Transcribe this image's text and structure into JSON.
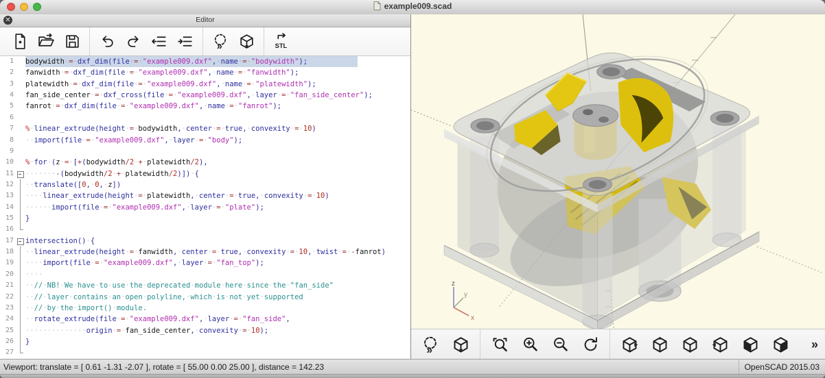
{
  "window": {
    "title": "example009.scad"
  },
  "titlebar": {
    "buttons": [
      "close-button",
      "minimize-button",
      "zoom-button"
    ]
  },
  "editor": {
    "panel_title": "Editor",
    "close_glyph": "✕",
    "toolbar": {
      "groups": [
        [
          "new-file",
          "open",
          "save"
        ],
        [
          "undo",
          "redo",
          "unindent",
          "indent"
        ],
        [
          "preview",
          "render"
        ],
        [
          "export-stl"
        ]
      ]
    },
    "code": {
      "lines": [
        {
          "n": "1",
          "fold": "",
          "selected": true,
          "segments": [
            [
              "id",
              "bodywidth"
            ],
            [
              "op",
              " = "
            ],
            [
              "kw",
              "dxf_dim"
            ],
            [
              "kw",
              "("
            ],
            [
              "kw",
              "file"
            ],
            [
              "op",
              " = "
            ],
            [
              "str",
              "\"example009.dxf\""
            ],
            [
              "kw",
              ", "
            ],
            [
              "kw",
              "name"
            ],
            [
              "op",
              " = "
            ],
            [
              "str",
              "\"bodywidth\""
            ],
            [
              "kw",
              ");"
            ]
          ]
        },
        {
          "n": "2",
          "fold": "",
          "segments": [
            [
              "id",
              "fanwidth"
            ],
            [
              "op",
              " = "
            ],
            [
              "kw",
              "dxf_dim"
            ],
            [
              "kw",
              "("
            ],
            [
              "kw",
              "file"
            ],
            [
              "op",
              " = "
            ],
            [
              "str",
              "\"example009.dxf\""
            ],
            [
              "kw",
              ", "
            ],
            [
              "kw",
              "name"
            ],
            [
              "op",
              " = "
            ],
            [
              "str",
              "\"fanwidth\""
            ],
            [
              "kw",
              ");"
            ]
          ]
        },
        {
          "n": "3",
          "fold": "",
          "segments": [
            [
              "id",
              "platewidth"
            ],
            [
              "op",
              " = "
            ],
            [
              "kw",
              "dxf_dim"
            ],
            [
              "kw",
              "("
            ],
            [
              "kw",
              "file"
            ],
            [
              "op",
              " = "
            ],
            [
              "str",
              "\"example009.dxf\""
            ],
            [
              "kw",
              ", "
            ],
            [
              "kw",
              "name"
            ],
            [
              "op",
              " = "
            ],
            [
              "str",
              "\"platewidth\""
            ],
            [
              "kw",
              ");"
            ]
          ]
        },
        {
          "n": "4",
          "fold": "",
          "segments": [
            [
              "id",
              "fan_side_center"
            ],
            [
              "op",
              " = "
            ],
            [
              "kw",
              "dxf_cross"
            ],
            [
              "kw",
              "("
            ],
            [
              "kw",
              "file"
            ],
            [
              "op",
              " = "
            ],
            [
              "str",
              "\"example009.dxf\""
            ],
            [
              "kw",
              ", "
            ],
            [
              "kw",
              "layer"
            ],
            [
              "op",
              " = "
            ],
            [
              "str",
              "\"fan_side_center\""
            ],
            [
              "kw",
              ");"
            ]
          ]
        },
        {
          "n": "5",
          "fold": "",
          "segments": [
            [
              "id",
              "fanrot"
            ],
            [
              "op",
              " = "
            ],
            [
              "kw",
              "dxf_dim"
            ],
            [
              "kw",
              "("
            ],
            [
              "kw",
              "file"
            ],
            [
              "op",
              " = "
            ],
            [
              "str",
              "\"example009.dxf\""
            ],
            [
              "kw",
              ", "
            ],
            [
              "kw",
              "name"
            ],
            [
              "op",
              " = "
            ],
            [
              "str",
              "\"fanrot\""
            ],
            [
              "kw",
              ");"
            ]
          ]
        },
        {
          "n": "6",
          "fold": "",
          "segments": []
        },
        {
          "n": "7",
          "fold": "",
          "segments": [
            [
              "mod",
              "% "
            ],
            [
              "kw",
              "linear_extrude"
            ],
            [
              "kw",
              "("
            ],
            [
              "kw",
              "height"
            ],
            [
              "op",
              " = "
            ],
            [
              "id",
              "bodywidth"
            ],
            [
              "kw",
              ", "
            ],
            [
              "kw",
              "center"
            ],
            [
              "op",
              " = "
            ],
            [
              "kw",
              "true"
            ],
            [
              "kw",
              ", "
            ],
            [
              "kw",
              "convexity"
            ],
            [
              "op",
              " = "
            ],
            [
              "num",
              "10"
            ],
            [
              "kw",
              ")"
            ]
          ]
        },
        {
          "n": "8",
          "fold": "",
          "segments": [
            [
              "id",
              "  "
            ],
            [
              "kw",
              "import"
            ],
            [
              "kw",
              "("
            ],
            [
              "kw",
              "file"
            ],
            [
              "op",
              " = "
            ],
            [
              "str",
              "\"example009.dxf\""
            ],
            [
              "kw",
              ", "
            ],
            [
              "kw",
              "layer"
            ],
            [
              "op",
              " = "
            ],
            [
              "str",
              "\"body\""
            ],
            [
              "kw",
              ");"
            ]
          ]
        },
        {
          "n": "9",
          "fold": "",
          "segments": []
        },
        {
          "n": "10",
          "fold": "",
          "segments": [
            [
              "mod",
              "% "
            ],
            [
              "kw",
              "for"
            ],
            [
              "kw",
              " ("
            ],
            [
              "id",
              "z"
            ],
            [
              "op",
              " = "
            ],
            [
              "kw",
              "["
            ],
            [
              "op",
              "+"
            ],
            [
              "kw",
              "("
            ],
            [
              "id",
              "bodywidth"
            ],
            [
              "op",
              "/"
            ],
            [
              "num",
              "2"
            ],
            [
              "op",
              " + "
            ],
            [
              "id",
              "platewidth"
            ],
            [
              "op",
              "/"
            ],
            [
              "num",
              "2"
            ],
            [
              "kw",
              "),"
            ]
          ]
        },
        {
          "n": "11",
          "fold": "open",
          "segments": [
            [
              "id",
              "       "
            ],
            [
              "op",
              "-"
            ],
            [
              "kw",
              "("
            ],
            [
              "id",
              "bodywidth"
            ],
            [
              "op",
              "/"
            ],
            [
              "num",
              "2"
            ],
            [
              "op",
              " + "
            ],
            [
              "id",
              "platewidth"
            ],
            [
              "op",
              "/"
            ],
            [
              "num",
              "2"
            ],
            [
              "kw",
              ")]) {"
            ]
          ]
        },
        {
          "n": "12",
          "fold": "line",
          "segments": [
            [
              "id",
              "  "
            ],
            [
              "kw",
              "translate"
            ],
            [
              "kw",
              "(["
            ],
            [
              "num",
              "0"
            ],
            [
              "kw",
              ", "
            ],
            [
              "num",
              "0"
            ],
            [
              "kw",
              ", "
            ],
            [
              "id",
              "z"
            ],
            [
              "kw",
              "])"
            ]
          ]
        },
        {
          "n": "13",
          "fold": "line",
          "segments": [
            [
              "id",
              "    "
            ],
            [
              "kw",
              "linear_extrude"
            ],
            [
              "kw",
              "("
            ],
            [
              "kw",
              "height"
            ],
            [
              "op",
              " = "
            ],
            [
              "id",
              "platewidth"
            ],
            [
              "kw",
              ", "
            ],
            [
              "kw",
              "center"
            ],
            [
              "op",
              " = "
            ],
            [
              "kw",
              "true"
            ],
            [
              "kw",
              ", "
            ],
            [
              "kw",
              "convexity"
            ],
            [
              "op",
              " = "
            ],
            [
              "num",
              "10"
            ],
            [
              "kw",
              ")"
            ]
          ]
        },
        {
          "n": "14",
          "fold": "line",
          "segments": [
            [
              "id",
              "      "
            ],
            [
              "kw",
              "import"
            ],
            [
              "kw",
              "("
            ],
            [
              "kw",
              "file"
            ],
            [
              "op",
              " = "
            ],
            [
              "str",
              "\"example009.dxf\""
            ],
            [
              "kw",
              ", "
            ],
            [
              "kw",
              "layer"
            ],
            [
              "op",
              " = "
            ],
            [
              "str",
              "\"plate\""
            ],
            [
              "kw",
              ");"
            ]
          ]
        },
        {
          "n": "15",
          "fold": "line",
          "segments": [
            [
              "kw",
              "}"
            ]
          ]
        },
        {
          "n": "16",
          "fold": "end",
          "segments": []
        },
        {
          "n": "17",
          "fold": "open",
          "segments": [
            [
              "kw",
              "intersection"
            ],
            [
              "kw",
              "() {"
            ]
          ]
        },
        {
          "n": "18",
          "fold": "line",
          "segments": [
            [
              "id",
              "  "
            ],
            [
              "kw",
              "linear_extrude"
            ],
            [
              "kw",
              "("
            ],
            [
              "kw",
              "height"
            ],
            [
              "op",
              " = "
            ],
            [
              "id",
              "fanwidth"
            ],
            [
              "kw",
              ", "
            ],
            [
              "kw",
              "center"
            ],
            [
              "op",
              " = "
            ],
            [
              "kw",
              "true"
            ],
            [
              "kw",
              ", "
            ],
            [
              "kw",
              "convexity"
            ],
            [
              "op",
              " = "
            ],
            [
              "num",
              "10"
            ],
            [
              "kw",
              ", "
            ],
            [
              "kw",
              "twist"
            ],
            [
              "op",
              " = -"
            ],
            [
              "id",
              "fanrot"
            ],
            [
              "kw",
              ")"
            ]
          ]
        },
        {
          "n": "19",
          "fold": "line",
          "segments": [
            [
              "id",
              "    "
            ],
            [
              "kw",
              "import"
            ],
            [
              "kw",
              "("
            ],
            [
              "kw",
              "file"
            ],
            [
              "op",
              " = "
            ],
            [
              "str",
              "\"example009.dxf\""
            ],
            [
              "kw",
              ", "
            ],
            [
              "kw",
              "layer"
            ],
            [
              "op",
              " = "
            ],
            [
              "str",
              "\"fan_top\""
            ],
            [
              "kw",
              ");"
            ]
          ]
        },
        {
          "n": "20",
          "fold": "line",
          "segments": [
            [
              "id",
              "    "
            ]
          ]
        },
        {
          "n": "21",
          "fold": "line",
          "segments": [
            [
              "id",
              "  "
            ],
            [
              "com",
              "// NB! We have to use the deprecated module here since the \"fan_side\""
            ]
          ]
        },
        {
          "n": "22",
          "fold": "line",
          "segments": [
            [
              "id",
              "  "
            ],
            [
              "com",
              "// layer contains an open polyline, which is not yet supported"
            ]
          ]
        },
        {
          "n": "23",
          "fold": "line",
          "segments": [
            [
              "id",
              "  "
            ],
            [
              "com",
              "// by the import() module."
            ]
          ]
        },
        {
          "n": "24",
          "fold": "line",
          "segments": [
            [
              "id",
              "  "
            ],
            [
              "kw",
              "rotate_extrude"
            ],
            [
              "kw",
              "("
            ],
            [
              "kw",
              "file"
            ],
            [
              "op",
              " = "
            ],
            [
              "str",
              "\"example009.dxf\""
            ],
            [
              "kw",
              ", "
            ],
            [
              "kw",
              "layer"
            ],
            [
              "op",
              " = "
            ],
            [
              "str",
              "\"fan_side\""
            ],
            [
              "kw",
              ","
            ]
          ]
        },
        {
          "n": "25",
          "fold": "line",
          "segments": [
            [
              "id",
              "              "
            ],
            [
              "kw",
              "origin"
            ],
            [
              "op",
              " = "
            ],
            [
              "id",
              "fan_side_center"
            ],
            [
              "kw",
              ", "
            ],
            [
              "kw",
              "convexity"
            ],
            [
              "op",
              " = "
            ],
            [
              "num",
              "10"
            ],
            [
              "kw",
              ");"
            ]
          ]
        },
        {
          "n": "26",
          "fold": "line",
          "segments": [
            [
              "kw",
              "}"
            ]
          ]
        },
        {
          "n": "27",
          "fold": "end",
          "segments": []
        }
      ]
    }
  },
  "viewport": {
    "axes": {
      "x": "x",
      "y": "y",
      "z": "z"
    },
    "colors": {
      "background": "#fcfae6",
      "fan": "#ddc00e",
      "housing": "#d8d8d8",
      "axis_x": "#c87a6e",
      "axis_z": "#8585cf"
    },
    "toolbar": {
      "groups": [
        [
          "preview",
          "render"
        ],
        [
          "zoom-all",
          "zoom-in",
          "zoom-out",
          "reset-view"
        ],
        [
          "view-right",
          "view-top",
          "view-bottom",
          "view-left",
          "view-diagonal",
          "view-back"
        ]
      ],
      "more_glyph": "»"
    }
  },
  "statusbar": {
    "left": "Viewport: translate = [ 0.61 -1.31 -2.07 ], rotate = [ 55.00 0.00 25.00 ], distance = 142.23",
    "right": "OpenSCAD 2015.03"
  }
}
